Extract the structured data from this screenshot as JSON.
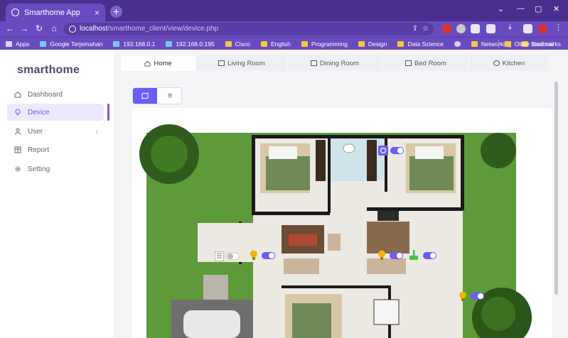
{
  "browser": {
    "tab_title": "Smarthome App",
    "url_host": "localhost",
    "url_path": "/smarthome_client/view/device.php",
    "bookmarks": [
      "Apps",
      "Google Terjemahan",
      "192.168.0.1",
      "192.168.0.195",
      "Cisco",
      "English",
      "Programming",
      "Design",
      "Data Science",
      "Networking",
      "Sechnid"
    ],
    "other_bookmarks": "Other bookmarks"
  },
  "sidebar": {
    "brand": "smarthome",
    "items": [
      {
        "label": "Dashboard",
        "icon": "home-icon"
      },
      {
        "label": "Device",
        "icon": "bulb-icon"
      },
      {
        "label": "User",
        "icon": "user-icon"
      },
      {
        "label": "Report",
        "icon": "table-icon"
      },
      {
        "label": "Setting",
        "icon": "gear-icon"
      }
    ]
  },
  "rooms": {
    "tabs": [
      {
        "label": "Home",
        "icon": "home-icon"
      },
      {
        "label": "Living Room",
        "icon": "sofa-icon"
      },
      {
        "label": "Dining Room",
        "icon": "table-icon"
      },
      {
        "label": "Bed Room",
        "icon": "bed-icon"
      },
      {
        "label": "Kitchen",
        "icon": "kitchen-icon"
      }
    ]
  },
  "devices": [
    {
      "type": "ac",
      "state": "on",
      "color": "#6a5cf5"
    },
    {
      "type": "heater",
      "state": "off",
      "color": "#6a5cf5"
    },
    {
      "type": "lamp",
      "state": "on",
      "color": "#f5b400"
    },
    {
      "type": "lamp",
      "state": "on",
      "color": "#f5b400"
    },
    {
      "type": "cleaner",
      "state": "on",
      "color": "#46c24a"
    },
    {
      "type": "lamp",
      "state": "on",
      "color": "#f5b400"
    }
  ],
  "colors": {
    "accent": "#6a5cf5",
    "chrome": "#6a4bbf"
  }
}
